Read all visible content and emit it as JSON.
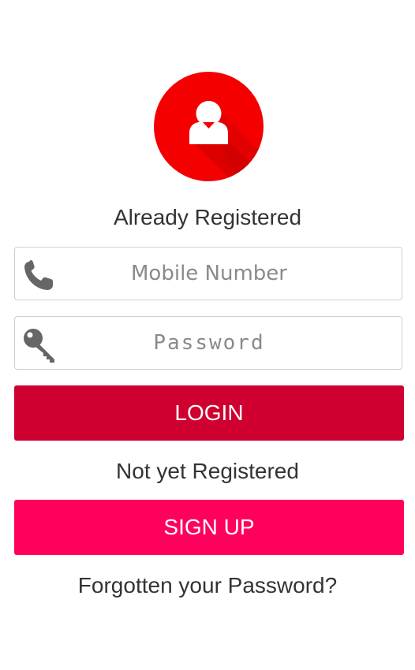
{
  "avatar": {
    "icon": "user-icon",
    "color": "#f50000"
  },
  "login_section": {
    "heading": "Already Registered",
    "mobile": {
      "icon": "phone-icon",
      "placeholder": "Mobile Number",
      "value": ""
    },
    "password": {
      "icon": "key-icon",
      "placeholder": "Password",
      "value": ""
    },
    "login_label": "LOGIN",
    "login_color": "#cf0030"
  },
  "signup_section": {
    "heading": "Not yet Registered",
    "signup_label": "SIGN UP",
    "signup_color": "#ff005c"
  },
  "forgot_link": "Forgotten your Password?"
}
